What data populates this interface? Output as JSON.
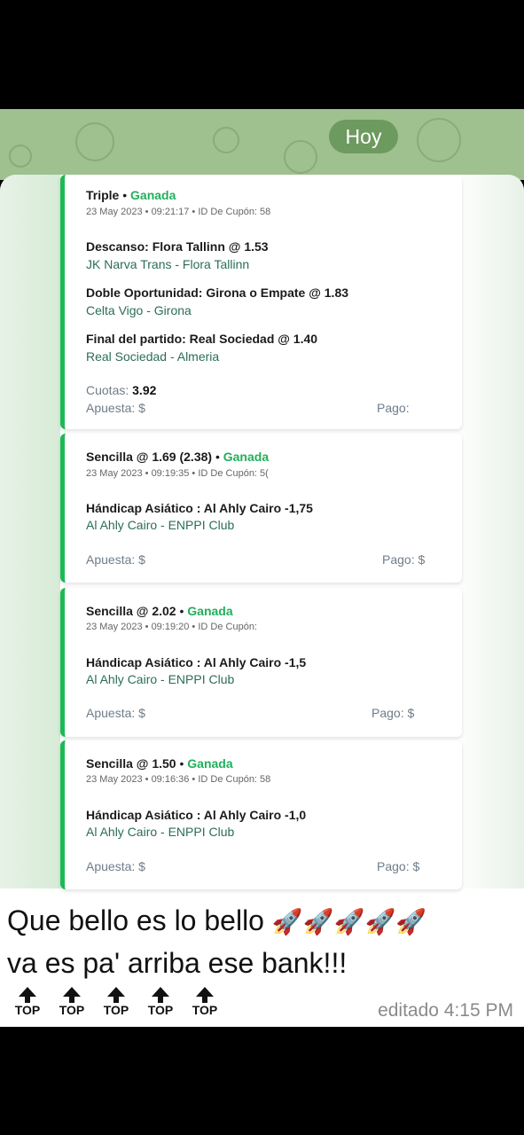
{
  "date_chip": "Hoy",
  "cards": [
    {
      "type": "Triple",
      "status": "Ganada",
      "meta": "23 May 2023 • 09:21:17 • ID De Cupón: 58",
      "picks": [
        {
          "pick": "Descanso: Flora Tallinn @ 1.53",
          "match": "JK Narva Trans - Flora Tallinn"
        },
        {
          "pick": "Doble Oportunidad: Girona o Empate @ 1.83",
          "match": "Celta Vigo - Girona"
        },
        {
          "pick": "Final del partido: Real Sociedad @ 1.40",
          "match": "Real Sociedad - Almeria"
        }
      ],
      "odds_label": "Cuotas:",
      "odds_value": "3.92",
      "stake_label": "Apuesta: $",
      "payout_label": "Pago: "
    },
    {
      "type": "Sencilla @ 1.69 (2.38)",
      "status": "Ganada",
      "meta": "23 May 2023 • 09:19:35 • ID De Cupón: 5(",
      "pick": "Hándicap Asiático : Al Ahly Cairo -1,75",
      "match": "Al Ahly Cairo - ENPPI Club",
      "stake_label": "Apuesta: $",
      "payout_label": "Pago: $"
    },
    {
      "type": "Sencilla @ 2.02",
      "status": "Ganada",
      "meta": "23 May 2023 • 09:19:20 • ID De Cupón:",
      "pick": "Hándicap Asiático : Al Ahly Cairo -1,5",
      "match": "Al Ahly Cairo - ENPPI Club",
      "stake_label": "Apuesta: $",
      "payout_label": "Pago: $"
    },
    {
      "type": "Sencilla @ 1.50",
      "status": "Ganada",
      "meta": "23 May 2023 • 09:16:36 • ID De Cupón: 58",
      "pick": "Hándicap Asiático : Al Ahly Cairo -1,0",
      "match": "Al Ahly Cairo - ENPPI Club",
      "stake_label": "Apuesta: $",
      "payout_label": "Pago: $"
    }
  ],
  "message": {
    "line1": "Que bello es lo bello",
    "line2": "va es pa' arriba ese bank!!!",
    "rocket": "🚀",
    "top_label": "TOP",
    "edited": "editado 4:15 PM"
  }
}
